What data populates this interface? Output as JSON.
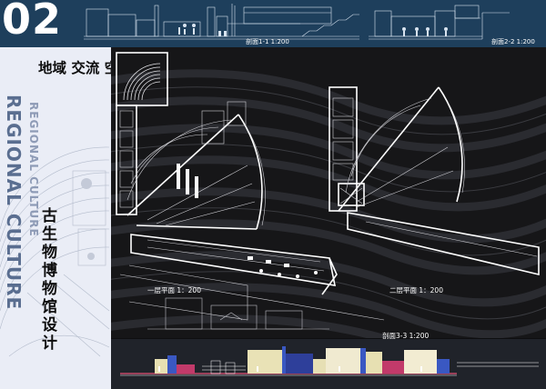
{
  "sheet": {
    "number": "02"
  },
  "sections": {
    "s1": "剖面1-1  1:200",
    "s2": "剖面2-2  1:200",
    "s3": "剖面3-3  1:200"
  },
  "title": {
    "lines": [
      "地域  交流  空间",
      "古生物博物馆设计"
    ],
    "english": "REGIONAL CULTURE"
  },
  "plans": {
    "floor1": "一层平面  1：200",
    "floor2": "二层平面  1：200"
  },
  "colors": {
    "banner": "#1e3f5c",
    "panel": "#eaedf6",
    "plan_bg": "#161618",
    "english_text": "#5a6e90"
  }
}
